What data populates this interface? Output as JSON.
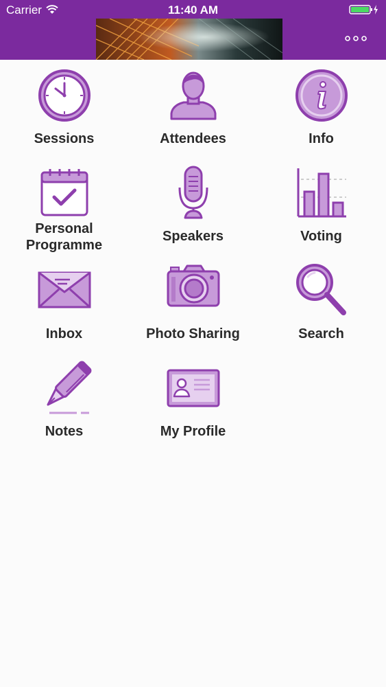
{
  "status_bar": {
    "carrier": "Carrier",
    "time": "11:40 AM"
  },
  "menu": [
    {
      "label": "Sessions",
      "icon": "clock-icon"
    },
    {
      "label": "Attendees",
      "icon": "person-icon"
    },
    {
      "label": "Info",
      "icon": "info-icon"
    },
    {
      "label": "Personal\nProgramme",
      "icon": "calendar-check-icon"
    },
    {
      "label": "Speakers",
      "icon": "microphone-icon"
    },
    {
      "label": "Voting",
      "icon": "bar-chart-icon"
    },
    {
      "label": "Inbox",
      "icon": "envelope-icon"
    },
    {
      "label": "Photo Sharing",
      "icon": "camera-icon"
    },
    {
      "label": "Search",
      "icon": "magnifier-icon"
    },
    {
      "label": "Notes",
      "icon": "pen-icon"
    },
    {
      "label": "My Profile",
      "icon": "id-card-icon"
    }
  ],
  "colors": {
    "header": "#7b2a9e",
    "icon_stroke": "#8e3fad",
    "icon_fill": "#c79ad9"
  }
}
